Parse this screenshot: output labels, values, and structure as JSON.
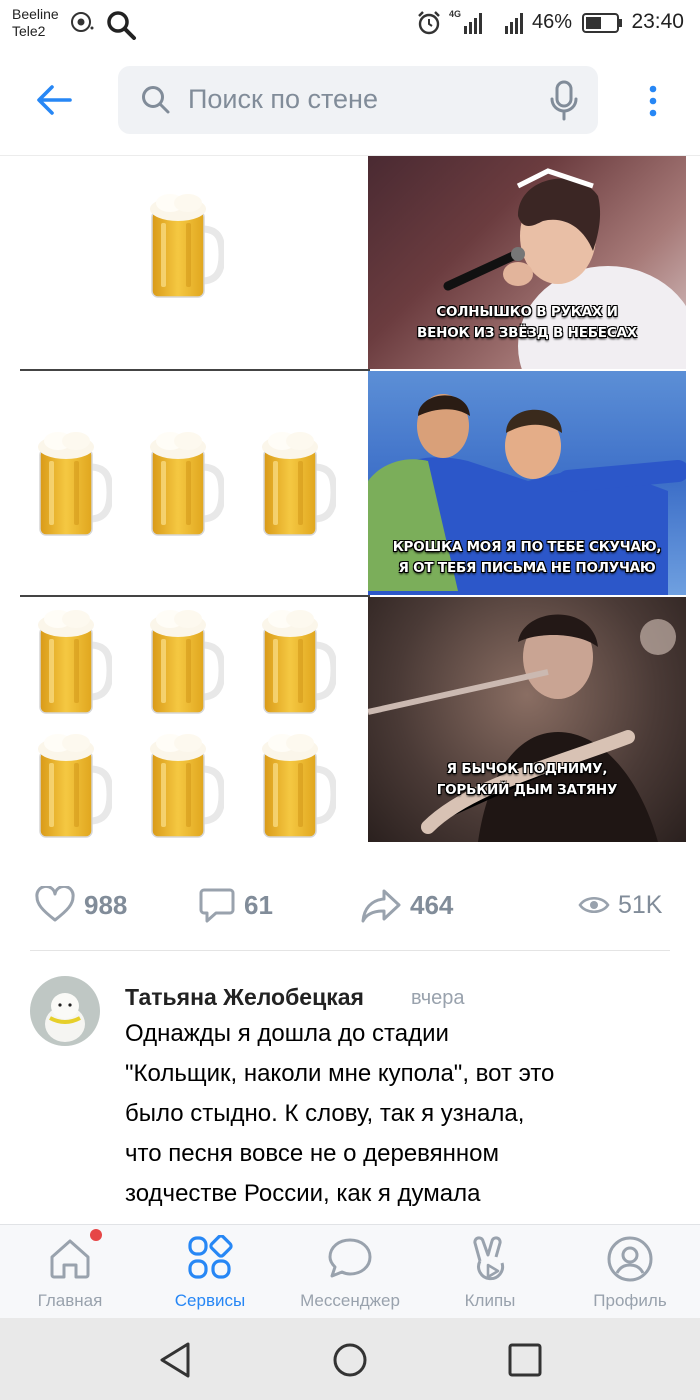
{
  "status_bar": {
    "carrier_1": "Beeline",
    "carrier_2": "Tele2",
    "network": "4G",
    "battery": "46%",
    "time": "23:40"
  },
  "header": {
    "search_placeholder": "Поиск по стене",
    "icons": [
      "back-arrow-icon",
      "search-icon",
      "microphone-icon",
      "more-vertical-icon"
    ]
  },
  "meme": {
    "rows": [
      {
        "mugs": 1,
        "caption": [
          "СОЛНЫШКО В РУКАХ И",
          "ВЕНОК ИЗ ЗВЁЗД В НЕБЕСАХ"
        ]
      },
      {
        "mugs": 3,
        "caption": [
          "КРОШКА МОЯ Я ПО ТЕБЕ СКУЧАЮ,",
          "Я ОТ ТЕБЯ ПИСЬМА НЕ ПОЛУЧАЮ"
        ]
      },
      {
        "mugs": 6,
        "caption": [
          "Я БЫЧОК ПОДНИМУ,",
          "ГОРЬКИЙ ДЫМ ЗАТЯНУ"
        ]
      }
    ]
  },
  "stats": {
    "likes": "988",
    "comments": "61",
    "shares": "464",
    "views": "51K"
  },
  "comment": {
    "author": "Татьяна Желобецкая",
    "time": "вчера",
    "lines": [
      "Однажды я дошла до стадии",
      "\"Кольщик, наколи мне купола\", вот это",
      "было стыдно. К слову, так я узнала,",
      "что песня вовсе не о деревянном",
      "зодчестве России, как я думала"
    ]
  },
  "tabs": [
    {
      "label": "Главная",
      "icon": "home-icon",
      "active": false,
      "badge": true
    },
    {
      "label": "Сервисы",
      "icon": "services-grid-icon",
      "active": true,
      "badge": false
    },
    {
      "label": "Мессенджер",
      "icon": "chat-bubble-icon",
      "active": false,
      "badge": false
    },
    {
      "label": "Клипы",
      "icon": "clips-icon",
      "active": false,
      "badge": false
    },
    {
      "label": "Профиль",
      "icon": "profile-icon",
      "active": false,
      "badge": false
    }
  ],
  "colors": {
    "accent": "#2787f5",
    "icon_gray": "#99a2ad",
    "stat_gray": "#818c99",
    "badge_red": "#e64646"
  }
}
